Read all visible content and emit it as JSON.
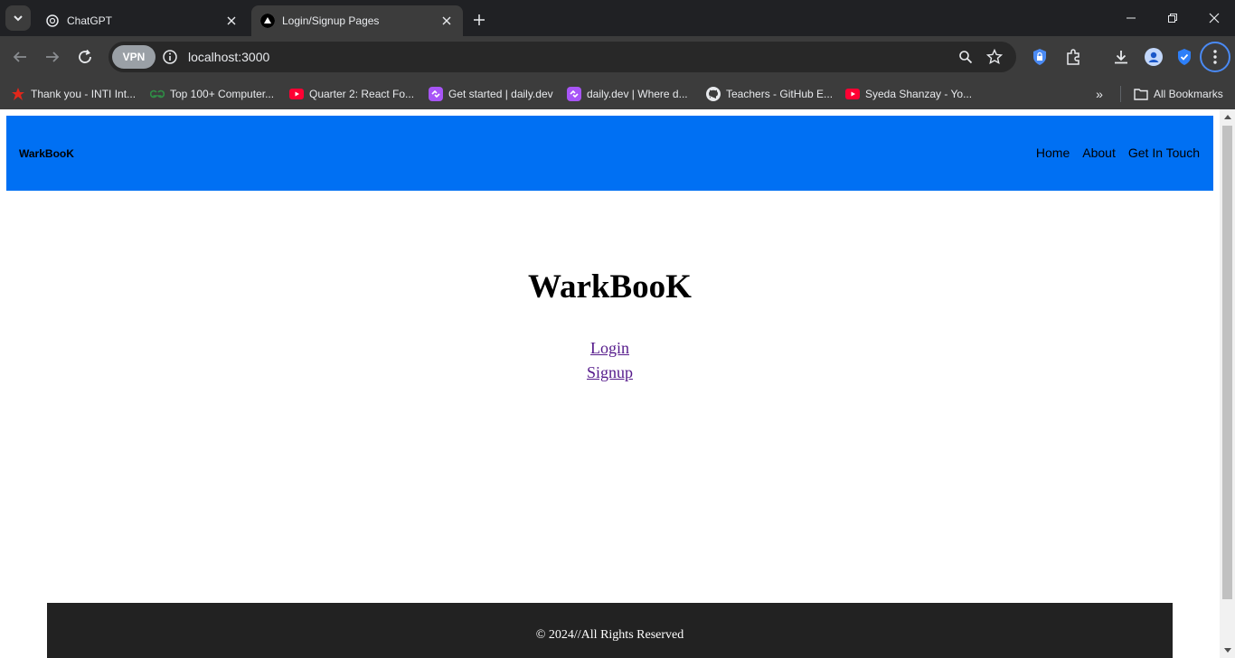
{
  "browser": {
    "tabs": [
      {
        "title": "ChatGPT",
        "icon": "chatgpt-icon",
        "active": false
      },
      {
        "title": "Login/Signup Pages",
        "icon": "nextjs-triangle-icon",
        "active": true
      }
    ],
    "url": "localhost:3000",
    "vpn_label": "VPN",
    "bookmarks": [
      {
        "label": "Thank you - INTI Int...",
        "icon": "inti-icon"
      },
      {
        "label": "Top 100+ Computer...",
        "icon": "gfg-icon"
      },
      {
        "label": "Quarter 2: React Fo...",
        "icon": "youtube-icon"
      },
      {
        "label": "Get started | daily.dev",
        "icon": "dailydev-icon"
      },
      {
        "label": "daily.dev | Where d...",
        "icon": "dailydev-icon"
      },
      {
        "label": "Teachers - GitHub E...",
        "icon": "github-icon"
      },
      {
        "label": "Syeda Shanzay - Yo...",
        "icon": "youtube-icon"
      }
    ],
    "all_bookmarks_label": "All Bookmarks"
  },
  "site": {
    "brand": "WarkBooK",
    "nav": [
      {
        "label": "Home"
      },
      {
        "label": "About"
      },
      {
        "label": "Get In Touch"
      }
    ],
    "title": "WarkBooK",
    "links": [
      {
        "label": "Login"
      },
      {
        "label": "Signup"
      }
    ],
    "footer": "© 2024//All Rights Reserved"
  },
  "colors": {
    "nav_bg": "#0070f3",
    "footer_bg": "#222222",
    "visited_link": "#551a8b"
  }
}
